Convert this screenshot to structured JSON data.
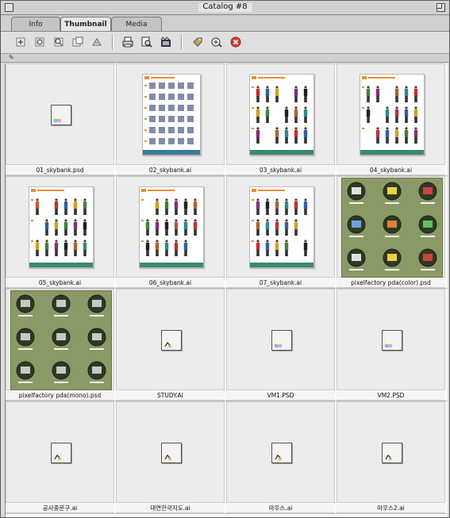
{
  "window": {
    "title": "Catalog #8"
  },
  "tabs": [
    {
      "label": "Info",
      "active": false
    },
    {
      "label": "Thumbnail",
      "active": true
    },
    {
      "label": "Media",
      "active": false
    }
  ],
  "toolbar": {
    "buttons": [
      {
        "name": "import-icon"
      },
      {
        "name": "update-icon"
      },
      {
        "name": "rebuild-icon"
      },
      {
        "name": "thumbnail-options-icon"
      },
      {
        "name": "sort-icon"
      },
      {
        "name": "print-icon"
      },
      {
        "name": "find-icon"
      },
      {
        "name": "slideshow-icon"
      },
      {
        "name": "tag-icon"
      },
      {
        "name": "export-icon"
      },
      {
        "name": "delete-icon"
      }
    ]
  },
  "colors": {
    "pda_green": "#8a9a66",
    "delete_red": "#d84040"
  },
  "items": [
    {
      "label": "01_skybank.psd",
      "kind": "psd-icon"
    },
    {
      "label": "02_skybank.ai",
      "kind": "sheet-dense"
    },
    {
      "label": "03_skybank.ai",
      "kind": "sheet-people"
    },
    {
      "label": "04_skybank.ai",
      "kind": "sheet-people"
    },
    {
      "label": "05_skybank.ai",
      "kind": "sheet-people"
    },
    {
      "label": "06_skybank.ai",
      "kind": "sheet-people"
    },
    {
      "label": "07_skybank.ai",
      "kind": "sheet-people"
    },
    {
      "label": "pixelfactory pda(color).psd",
      "kind": "pda"
    },
    {
      "label": "pixelfactory pda(mono).psd",
      "kind": "pda"
    },
    {
      "label": "STUDY.AI",
      "kind": "ai-icon"
    },
    {
      "label": "VM1.PSD",
      "kind": "psd-icon"
    },
    {
      "label": "VM2.PSD",
      "kind": "psd-icon"
    },
    {
      "label": "공사중문구.ai",
      "kind": "ai-icon"
    },
    {
      "label": "대연안국지도.ai",
      "kind": "ai-icon"
    },
    {
      "label": "마우스.ai",
      "kind": "ai-icon"
    },
    {
      "label": "마우스2.ai",
      "kind": "ai-icon"
    }
  ]
}
